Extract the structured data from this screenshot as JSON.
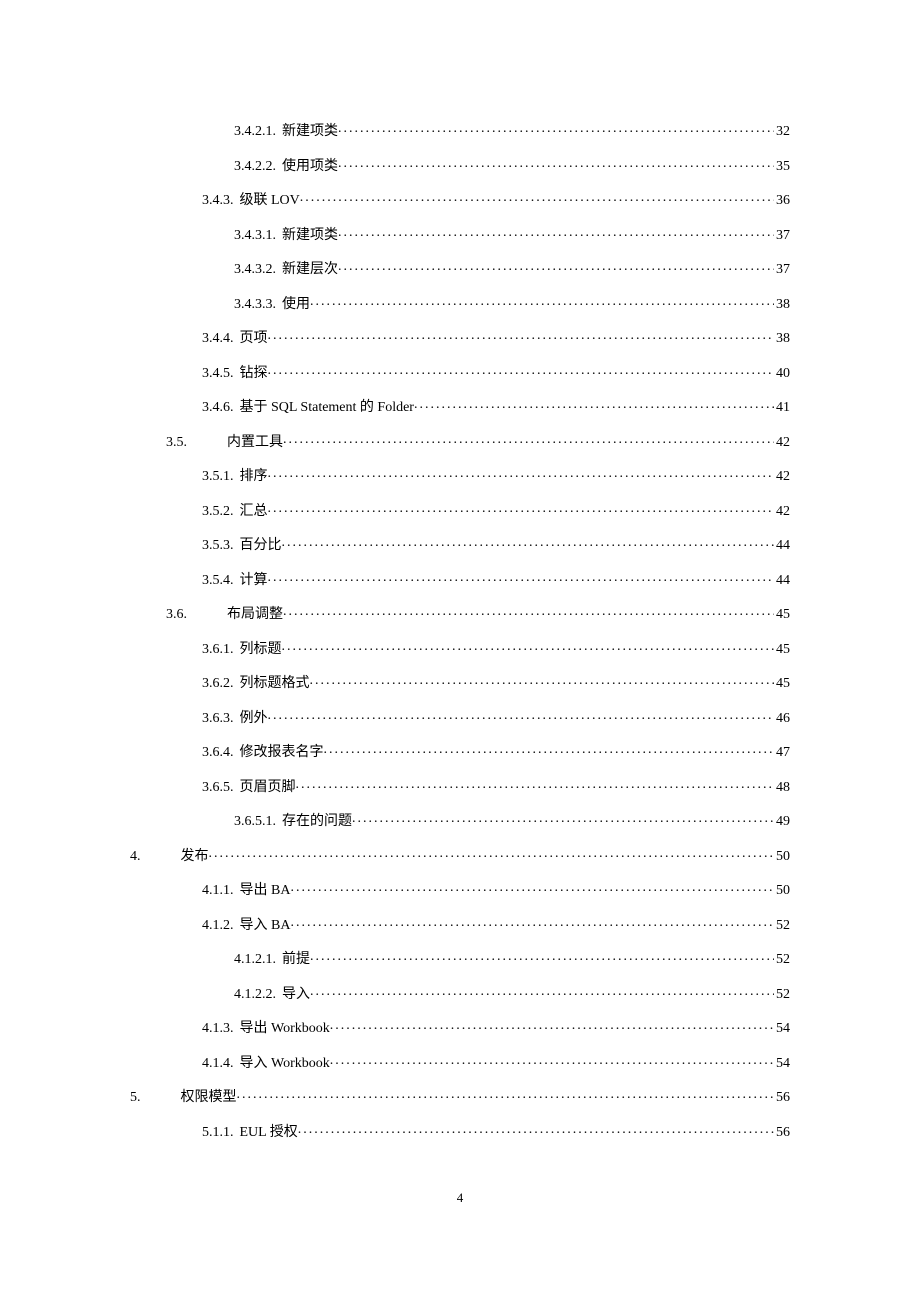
{
  "page_number": "4",
  "toc": [
    {
      "indent": "indent-4",
      "num": "3.4.2.1.",
      "gap": "small",
      "title": "新建项类",
      "page": "32"
    },
    {
      "indent": "indent-4",
      "num": "3.4.2.2.",
      "gap": "small",
      "title": "使用项类",
      "page": "35"
    },
    {
      "indent": "indent-3",
      "num": "3.4.3.",
      "gap": "small",
      "title": "级联 LOV",
      "page": "36"
    },
    {
      "indent": "indent-4",
      "num": "3.4.3.1.",
      "gap": "small",
      "title": "新建项类",
      "page": "37"
    },
    {
      "indent": "indent-4",
      "num": "3.4.3.2.",
      "gap": "small",
      "title": "新建层次",
      "page": "37"
    },
    {
      "indent": "indent-4",
      "num": "3.4.3.3.",
      "gap": "small",
      "title": "使用",
      "page": "38"
    },
    {
      "indent": "indent-3",
      "num": "3.4.4.",
      "gap": "small",
      "title": "页项",
      "page": "38"
    },
    {
      "indent": "indent-3",
      "num": "3.4.5.",
      "gap": "small",
      "title": "钻探",
      "page": "40"
    },
    {
      "indent": "indent-3",
      "num": "3.4.6.",
      "gap": "small",
      "title": "基于 SQL Statement  的 Folder",
      "page": "41"
    },
    {
      "indent": "indent-2w",
      "num": "3.5.",
      "gap": "wide",
      "title": "内置工具",
      "page": "42"
    },
    {
      "indent": "indent-3",
      "num": "3.5.1.",
      "gap": "small",
      "title": "排序",
      "page": "42"
    },
    {
      "indent": "indent-3",
      "num": "3.5.2.",
      "gap": "small",
      "title": "汇总",
      "page": "42"
    },
    {
      "indent": "indent-3",
      "num": "3.5.3.",
      "gap": "small",
      "title": "百分比",
      "page": "44"
    },
    {
      "indent": "indent-3",
      "num": "3.5.4.",
      "gap": "small",
      "title": "计算",
      "page": "44"
    },
    {
      "indent": "indent-2w",
      "num": "3.6.",
      "gap": "wide",
      "title": "布局调整",
      "page": "45"
    },
    {
      "indent": "indent-3",
      "num": "3.6.1.",
      "gap": "small",
      "title": "列标题",
      "page": "45"
    },
    {
      "indent": "indent-3",
      "num": "3.6.2.",
      "gap": "small",
      "title": "列标题格式",
      "page": "45"
    },
    {
      "indent": "indent-3",
      "num": "3.6.3.",
      "gap": "small",
      "title": "例外",
      "page": "46"
    },
    {
      "indent": "indent-3",
      "num": "3.6.4.",
      "gap": "small",
      "title": "修改报表名字",
      "page": "47"
    },
    {
      "indent": "indent-3",
      "num": "3.6.5.",
      "gap": "small",
      "title": "页眉页脚",
      "page": "48"
    },
    {
      "indent": "indent-4",
      "num": "3.6.5.1.",
      "gap": "small",
      "title": "存在的问题",
      "page": "49"
    },
    {
      "indent": "indent-0",
      "num": "4.",
      "gap": "wide",
      "title": "发布",
      "page": "50"
    },
    {
      "indent": "indent-3",
      "num": "4.1.1.",
      "gap": "small",
      "title": "导出 BA",
      "page": "50"
    },
    {
      "indent": "indent-3",
      "num": "4.1.2.",
      "gap": "small",
      "title": "导入 BA",
      "page": "52"
    },
    {
      "indent": "indent-4",
      "num": "4.1.2.1.",
      "gap": "small",
      "title": "前提",
      "page": "52"
    },
    {
      "indent": "indent-4",
      "num": "4.1.2.2.",
      "gap": "small",
      "title": "导入",
      "page": "52"
    },
    {
      "indent": "indent-3",
      "num": "4.1.3.",
      "gap": "small",
      "title": "导出 Workbook",
      "page": "54"
    },
    {
      "indent": "indent-3",
      "num": "4.1.4.",
      "gap": "small",
      "title": "导入 Workbook",
      "page": "54"
    },
    {
      "indent": "indent-0",
      "num": "5.",
      "gap": "wide",
      "title": "权限模型",
      "page": "56"
    },
    {
      "indent": "indent-3",
      "num": "5.1.1.",
      "gap": "small",
      "title": "EUL 授权",
      "page": "56"
    }
  ]
}
